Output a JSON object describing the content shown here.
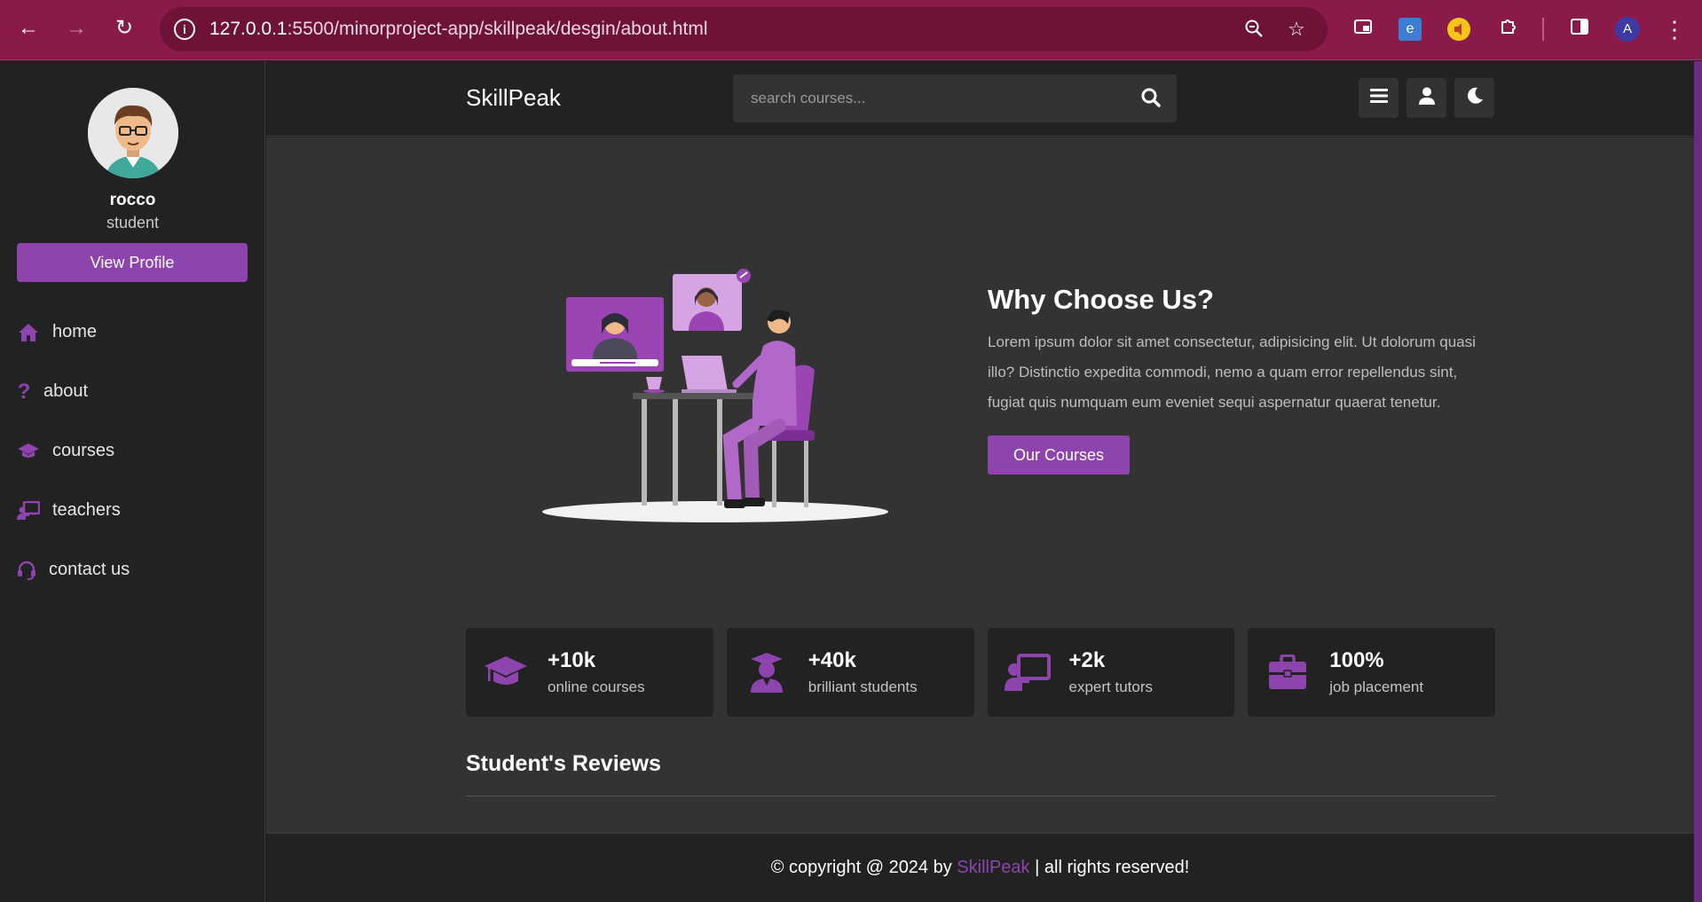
{
  "browser": {
    "url_host": "127.0.0.1",
    "url_path": ":5500/minorproject-app/skillpeak/desgin/about.html",
    "profile_initial": "A"
  },
  "sidebar": {
    "username": "rocco",
    "role": "student",
    "view_profile_label": "View Profile",
    "items": [
      {
        "label": "home",
        "icon": "home-icon"
      },
      {
        "label": "about",
        "icon": "question-icon"
      },
      {
        "label": "courses",
        "icon": "graduation-cap-icon"
      },
      {
        "label": "teachers",
        "icon": "chalkboard-teacher-icon"
      },
      {
        "label": "contact us",
        "icon": "headset-icon"
      }
    ]
  },
  "header": {
    "logo": "SkillPeak",
    "search_placeholder": "search courses..."
  },
  "about": {
    "title": "Why Choose Us?",
    "text": "Lorem ipsum dolor sit amet consectetur, adipisicing elit. Ut dolorum quasi illo? Distinctio expedita commodi, nemo a quam error repellendus sint, fugiat quis numquam eum eveniet sequi aspernatur quaerat tenetur.",
    "button_label": "Our Courses"
  },
  "stats": [
    {
      "value": "+10k",
      "label": "online courses",
      "icon": "graduation-cap-icon"
    },
    {
      "value": "+40k",
      "label": "brilliant students",
      "icon": "user-graduate-icon"
    },
    {
      "value": "+2k",
      "label": "expert tutors",
      "icon": "chalkboard-teacher-icon"
    },
    {
      "value": "100%",
      "label": "job placement",
      "icon": "briefcase-icon"
    }
  ],
  "reviews": {
    "title": "Student's Reviews"
  },
  "footer": {
    "prefix": "© copyright @ 2024 by ",
    "brand": "SkillPeak",
    "suffix": " | all rights reserved!"
  },
  "colors": {
    "accent": "#8e44ad",
    "chrome": "#8a1a4a",
    "panel": "#222222",
    "content_bg": "#333333"
  }
}
